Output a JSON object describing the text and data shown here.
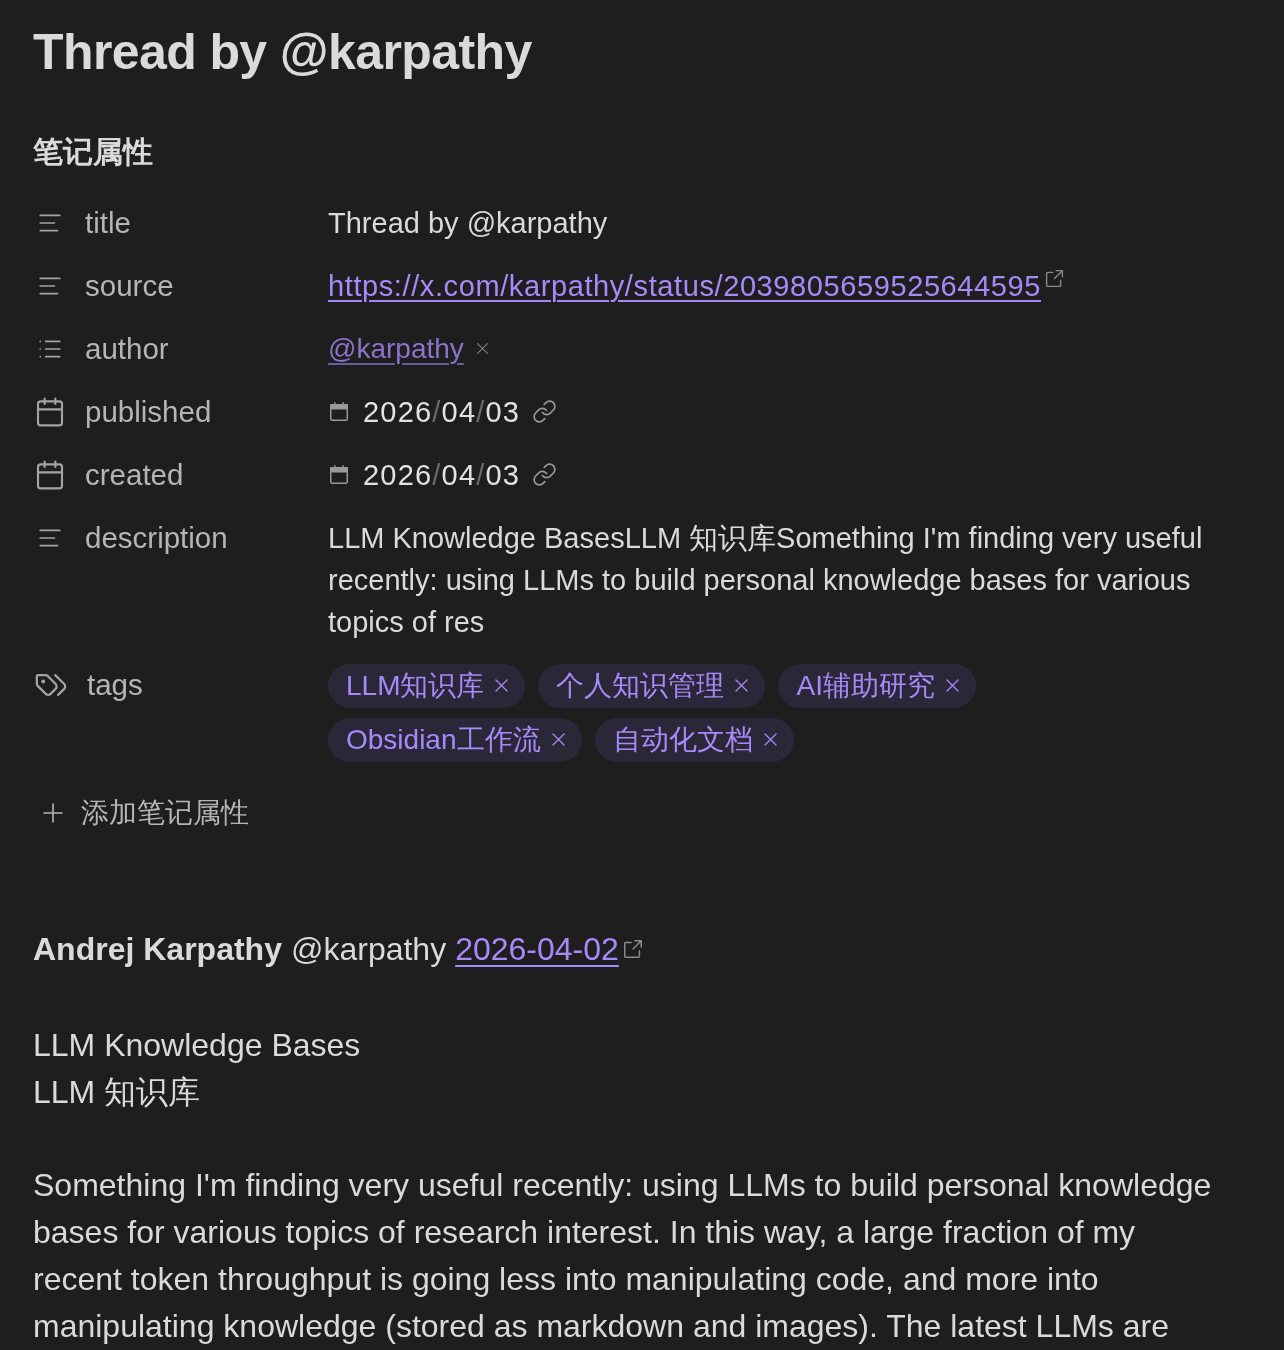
{
  "note": {
    "title": "Thread by @karpathy"
  },
  "properties": {
    "heading": "笔记属性",
    "items": [
      {
        "kind": "text",
        "key": "title",
        "value": "Thread by @karpathy"
      },
      {
        "kind": "url",
        "key": "source",
        "value": "https://x.com/karpathy/status/2039805659525644595"
      },
      {
        "kind": "list",
        "key": "author",
        "items": [
          "@karpathy"
        ]
      },
      {
        "kind": "date",
        "key": "published",
        "value": "2026/04/03"
      },
      {
        "kind": "date",
        "key": "created",
        "value": "2026/04/03"
      },
      {
        "kind": "text",
        "key": "description",
        "value": "LLM Knowledge BasesLLM 知识库Something I'm finding very useful recently: using LLMs to build personal knowledge bases for various topics of res"
      },
      {
        "kind": "tags",
        "key": "tags",
        "items": [
          "LLM知识库",
          "个人知识管理",
          "AI辅助研究",
          "Obsidian工作流",
          "自动化文档"
        ]
      }
    ],
    "add_label": "添加笔记属性"
  },
  "post": {
    "author_name": "Andrej Karpathy",
    "handle": "@karpathy",
    "date": "2026-04-02",
    "lines": [
      "LLM Knowledge Bases",
      "LLM 知识库"
    ],
    "paragraph": "Something I'm finding very useful recently: using LLMs to build personal knowledge bases for various topics of research interest. In this way, a large fraction of my recent token throughput is going less into manipulating code, and more into manipulating knowledge (stored as markdown and images). The latest LLMs are"
  }
}
